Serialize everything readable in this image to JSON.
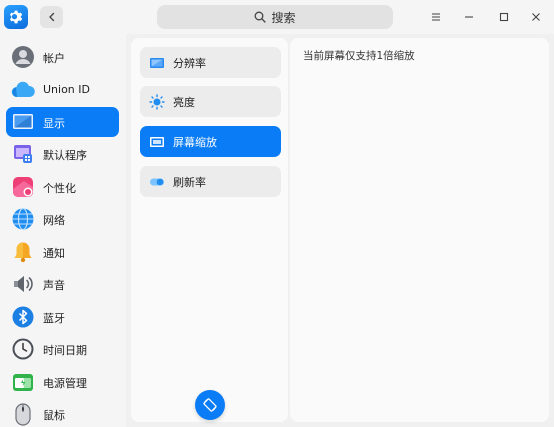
{
  "titlebar": {
    "search_placeholder": "搜索",
    "app_icon": "settings-gear-icon",
    "back_icon": "chevron-left-icon",
    "menu_icon": "menu-icon",
    "minimize_icon": "minimize-icon",
    "maximize_icon": "maximize-icon",
    "close_icon": "close-icon"
  },
  "sidebar": {
    "items": [
      {
        "label": "帐户",
        "icon": "account-avatar-icon",
        "active": false
      },
      {
        "label": "Union ID",
        "icon": "cloud-icon",
        "active": false
      },
      {
        "label": "显示",
        "icon": "display-monitor-icon",
        "active": true
      },
      {
        "label": "默认程序",
        "icon": "default-apps-icon",
        "active": false
      },
      {
        "label": "个性化",
        "icon": "personalization-icon",
        "active": false
      },
      {
        "label": "网络",
        "icon": "network-globe-icon",
        "active": false
      },
      {
        "label": "通知",
        "icon": "notification-bell-icon",
        "active": false
      },
      {
        "label": "声音",
        "icon": "speaker-icon",
        "active": false
      },
      {
        "label": "蓝牙",
        "icon": "bluetooth-icon",
        "active": false
      },
      {
        "label": "时间日期",
        "icon": "clock-icon",
        "active": false
      },
      {
        "label": "电源管理",
        "icon": "battery-icon",
        "active": false
      },
      {
        "label": "鼠标",
        "icon": "mouse-icon",
        "active": false
      }
    ]
  },
  "display_menu": {
    "items": [
      {
        "label": "分辨率",
        "icon": "resolution-icon",
        "active": false
      },
      {
        "label": "亮度",
        "icon": "brightness-sun-icon",
        "active": false
      },
      {
        "label": "屏幕缩放",
        "icon": "screen-scale-icon",
        "active": true
      },
      {
        "label": "刷新率",
        "icon": "refresh-rate-toggle-icon",
        "active": false
      }
    ],
    "rotate_icon": "rotate-screen-icon"
  },
  "content": {
    "message": "当前屏幕仅支持1倍缩放"
  },
  "colors": {
    "accent": "#0a7cf5"
  }
}
